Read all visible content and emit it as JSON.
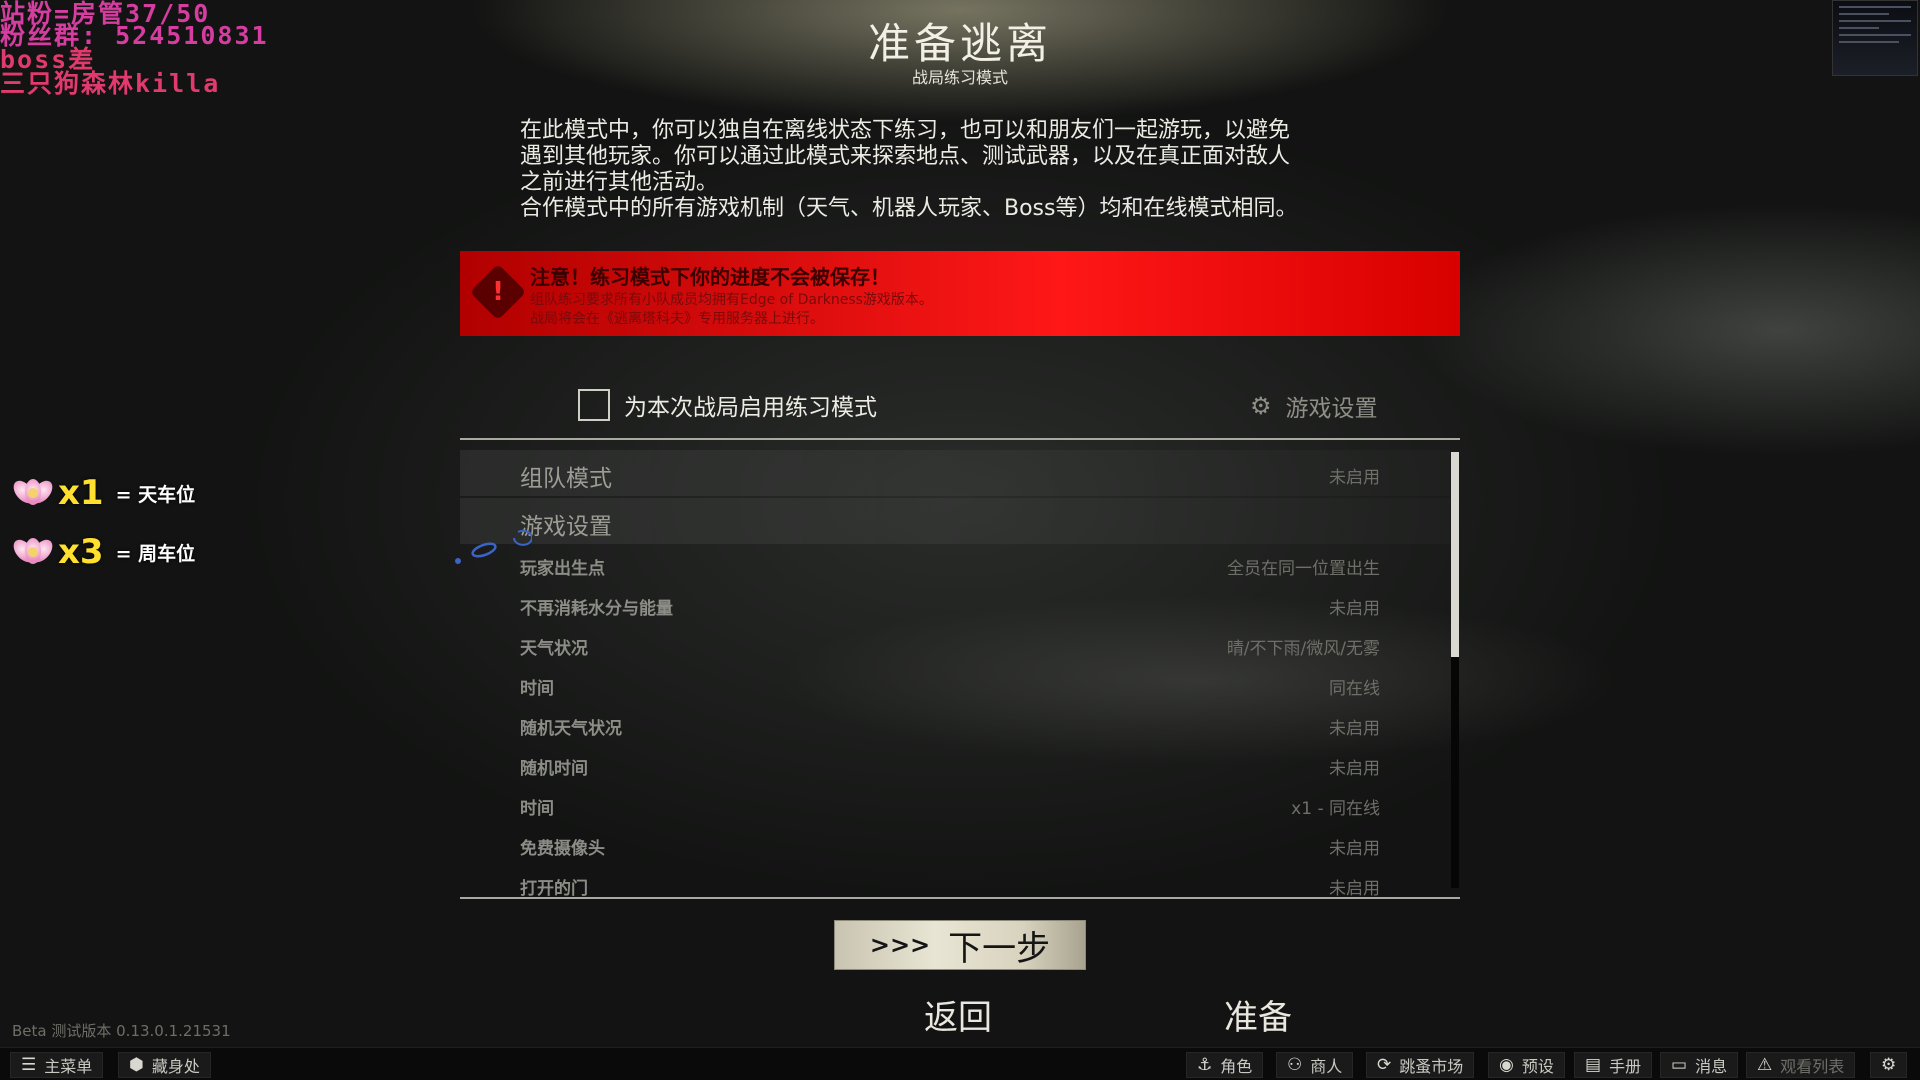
{
  "overlay": {
    "line1": "站粉=房管37/50",
    "line2": "粉丝群: 524510831",
    "line3": "boss差",
    "line4": "三只狗森林killa"
  },
  "badges": [
    {
      "multiplier": "x1",
      "label": "= 天车位"
    },
    {
      "multiplier": "x3",
      "label": "= 周车位"
    }
  ],
  "header": {
    "title": "准备逃离",
    "subtitle": "战局练习模式"
  },
  "description": [
    "在此模式中，你可以独自在离线状态下练习，也可以和朋友们一起游玩，以避免",
    "遇到其他玩家。你可以通过此模式来探索地点、测试武器，以及在真正面对敌人",
    "之前进行其他活动。",
    "合作模式中的所有游戏机制（天气、机器人玩家、Boss等）均和在线模式相同。"
  ],
  "warning": {
    "icon": "exclamation-icon",
    "title": "注意！练习模式下你的进度不会被保存！",
    "line1": "组队练习要求所有小队成员均拥有Edge of Darkness游戏版本。",
    "line2": "战局将会在《逃离塔科夫》专用服务器上进行。",
    "color": "#e41010"
  },
  "practice_toggle": {
    "label": "为本次战局启用练习模式",
    "checked": false
  },
  "settings_link": {
    "label": "游戏设置",
    "icon": "gear-icon"
  },
  "sections": [
    {
      "label": "组队模式",
      "value": "未启用"
    },
    {
      "label": "游戏设置",
      "value": ""
    }
  ],
  "settings": [
    {
      "label": "玩家出生点",
      "value": "全员在同一位置出生"
    },
    {
      "label": "不再消耗水分与能量",
      "value": "未启用"
    },
    {
      "label": "天气状况",
      "value": "晴/不下雨/微风/无雾"
    },
    {
      "label": "时间",
      "value": "同在线"
    },
    {
      "label": "随机天气状况",
      "value": "未启用"
    },
    {
      "label": "随机时间",
      "value": "未启用"
    },
    {
      "label": "时间",
      "value": "x1 - 同在线"
    },
    {
      "label": "免费摄像头",
      "value": "未启用"
    },
    {
      "label": "打开的门",
      "value": "未启用"
    }
  ],
  "actions": {
    "next_arrows": ">>>",
    "next_label": "下一步",
    "back_label": "返回",
    "ready_label": "准备"
  },
  "version": "Beta 测试版本 0.13.0.1.21531",
  "bottom_bar": {
    "main_menu": "主菜单",
    "hideout": "藏身处",
    "character": "角色",
    "traders": "商人",
    "flea_market": "跳蚤市场",
    "presets": "预设",
    "handbook": "手册",
    "messages": "消息",
    "watchlist": "观看列表"
  }
}
